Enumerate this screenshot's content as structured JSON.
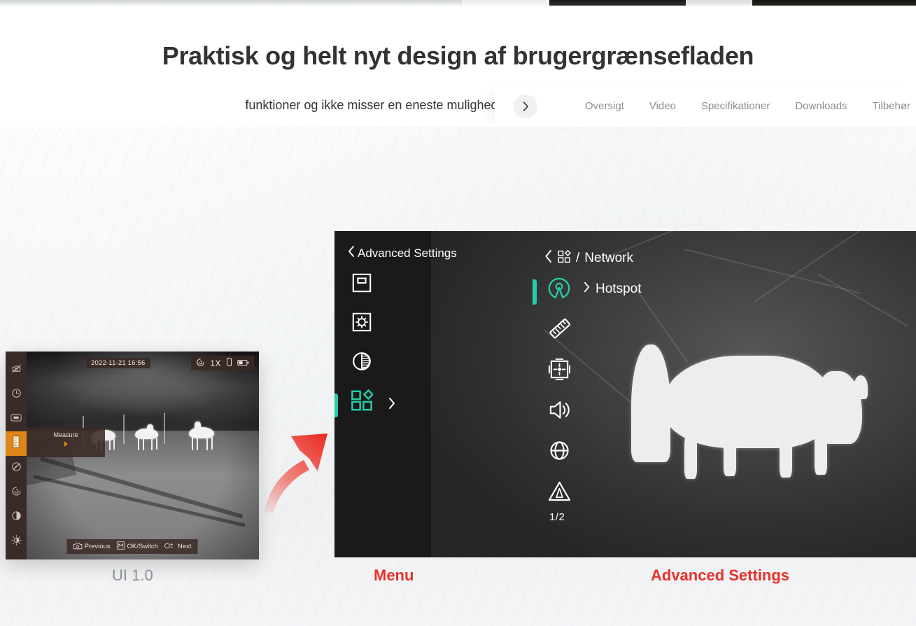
{
  "hero": {
    "heading": "Praktisk og helt nyt design af brugergrænsefladen",
    "paragraph": "funktioner og ikke misser en eneste mulighed for at holde øje med dit objekt."
  },
  "subnav": {
    "arrow_icon": "chevron-right-icon",
    "links": [
      {
        "label": "Oversigt"
      },
      {
        "label": "Video"
      },
      {
        "label": "Specifikationer"
      },
      {
        "label": "Downloads"
      },
      {
        "label": "Tilbehør"
      }
    ]
  },
  "ui10": {
    "caption": "UI 1.0",
    "topbar": {
      "timestamp": "2022-11-21 16:56",
      "zoom_icon": "zoom-spiral-icon",
      "zoom_level": "1X",
      "palette_icon": "palette-icon",
      "battery_icon": "battery-icon"
    },
    "sidebar": [
      {
        "icon": "camera-off-icon",
        "active": false
      },
      {
        "icon": "clock-icon",
        "active": false
      },
      {
        "icon": "osd-label-icon",
        "active": false
      },
      {
        "icon": "ruler-measure-icon",
        "active": true
      },
      {
        "icon": "hotspot-off-icon",
        "active": false
      },
      {
        "icon": "zoom-spiral-icon",
        "active": false
      },
      {
        "icon": "contrast-icon",
        "active": false
      },
      {
        "icon": "brightness-icon",
        "active": false
      }
    ],
    "tooltip": {
      "label": "Measure",
      "caret_icon": "triangle-right-icon"
    },
    "bottombar": [
      {
        "icon": "camera-icon",
        "label": "Previous"
      },
      {
        "icon": "m-key-icon",
        "label": "OK/Switch"
      },
      {
        "icon": "zoom-plusminus-icon",
        "label": "Next"
      }
    ]
  },
  "menu": {
    "caption": "Menu",
    "title": "Advanced Settings",
    "back_icon": "chevron-left-icon",
    "items": [
      {
        "icon": "picture-in-picture-icon",
        "active": false
      },
      {
        "icon": "brightness-frame-icon",
        "active": false
      },
      {
        "icon": "contrast-half-circle-icon",
        "active": false
      },
      {
        "icon": "apps-grid-icon",
        "active": true
      }
    ],
    "expand_icon": "chevron-right-icon"
  },
  "advanced": {
    "caption": "Advanced Settings",
    "back_icon": "chevron-left-icon",
    "breadcrumb_icon": "apps-grid-icon",
    "breadcrumb_separator": "/",
    "breadcrumb_label": "Network",
    "selected": {
      "chevron_icon": "chevron-right-icon",
      "label": "Hotspot",
      "icon": "hotspot-antenna-icon"
    },
    "items": [
      {
        "icon": "hotspot-antenna-icon",
        "active": true
      },
      {
        "icon": "ruler-icon",
        "active": false
      },
      {
        "icon": "target-frame-icon",
        "active": false
      },
      {
        "icon": "speaker-icon",
        "active": false
      },
      {
        "icon": "globe-icon",
        "active": false
      },
      {
        "icon": "warning-triangle-icon",
        "active": false
      }
    ],
    "page_indicator": "1/2"
  },
  "colors": {
    "accent_teal": "#23cfa8",
    "accent_orange": "#de8718",
    "caption_red": "#e8312a",
    "heading_gray": "#333333",
    "nav_link_gray": "#8c8c8c"
  }
}
